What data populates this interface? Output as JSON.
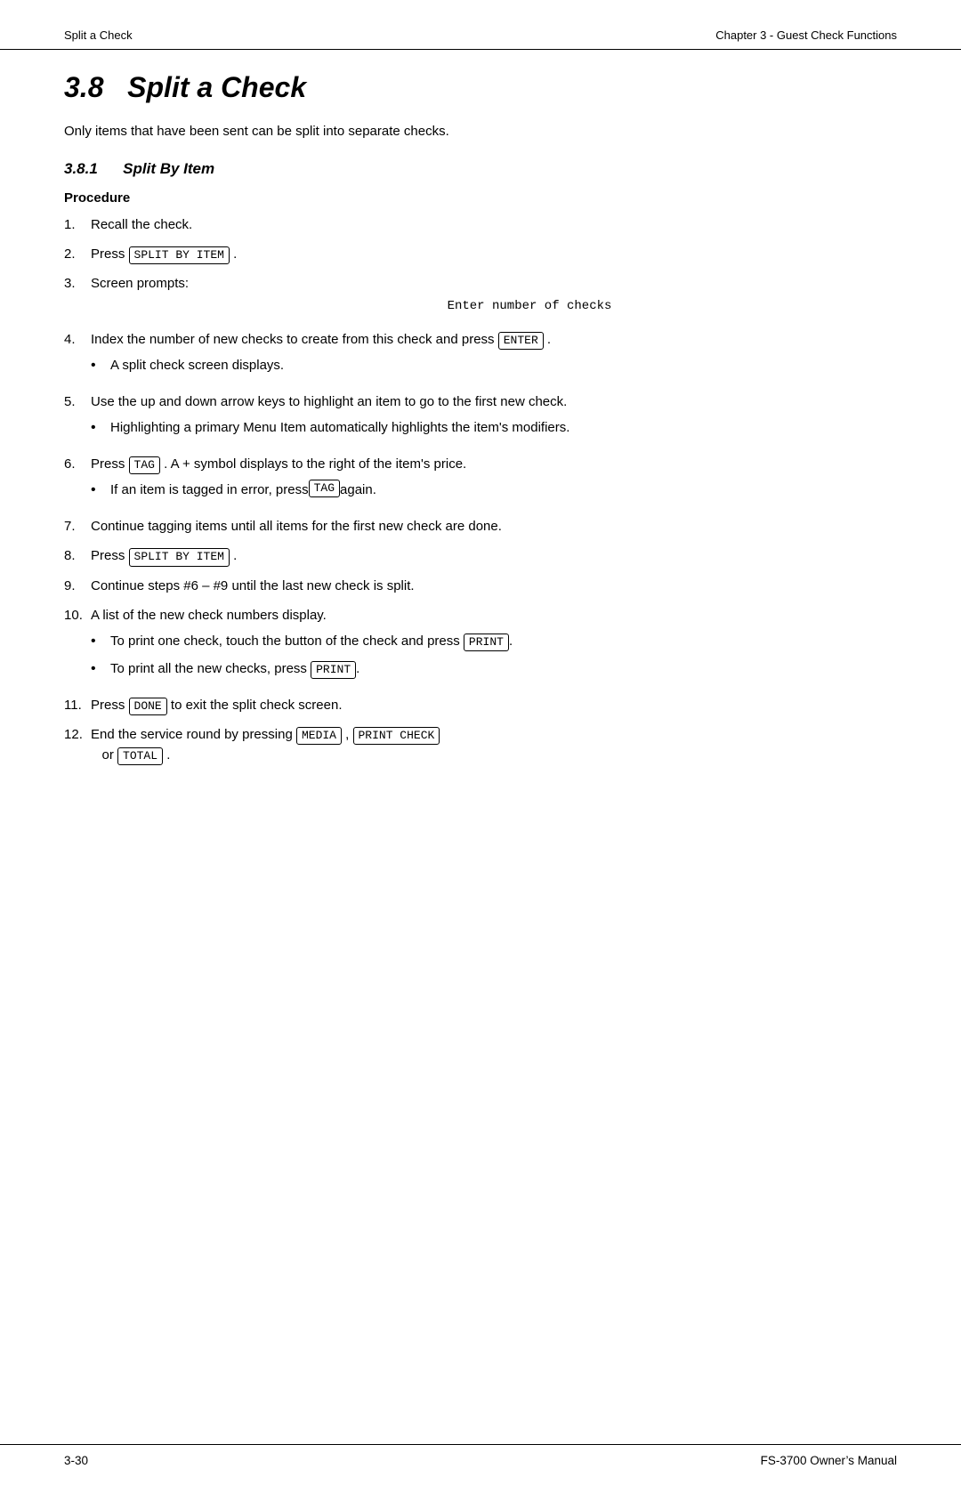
{
  "header": {
    "left": "Split a Check",
    "right": "Chapter 3 - Guest Check Functions"
  },
  "chapter": {
    "number": "3.8",
    "title": "Split a Check"
  },
  "intro": "Only items that have been sent can be split into separate checks.",
  "subsection": {
    "number": "3.8.1",
    "title": "Split By Item"
  },
  "procedure_heading": "Procedure",
  "steps": [
    {
      "text": "Recall the check.",
      "bullets": []
    },
    {
      "text_before": "Press ",
      "key": "SPLIT BY ITEM",
      "text_after": ".",
      "bullets": []
    },
    {
      "text": "Screen prompts:",
      "prompt": "Enter number of checks",
      "bullets": []
    },
    {
      "text_before": "Index the number of new checks to create from this check and press ",
      "key": "ENTER",
      "text_after": ".",
      "bullets": [
        "A split check screen displays."
      ]
    },
    {
      "text": "Use the up and down arrow keys to highlight an item to go to the first new check.",
      "bullets": [
        "Highlighting a primary Menu Item automatically highlights the item’s modifiers."
      ]
    },
    {
      "text_before": "Press ",
      "key": "TAG",
      "text_after": ". A + symbol displays to the right of the item’s price.",
      "bullets": [
        "If an item is tagged in error, press [TAG] again."
      ],
      "bullet_key_index": 0,
      "bullet_key": "TAG"
    },
    {
      "text": "Continue tagging items until all items for the first new check are done.",
      "bullets": []
    },
    {
      "text_before": "Press ",
      "key": "SPLIT BY ITEM",
      "text_after": ".",
      "bullets": []
    },
    {
      "text": "Continue steps #6 – #9 until the last new check is split.",
      "bullets": []
    },
    {
      "text": "A list of the new check numbers display.",
      "bullets": [
        "To print one check, touch the button of the check and press [PRINT].",
        "To print all the new checks, press [PRINT]."
      ],
      "bullet_keys": [
        "PRINT",
        "PRINT"
      ]
    },
    {
      "text_before": "Press ",
      "key": "DONE",
      "text_after": " to exit the split check screen.",
      "bullets": []
    },
    {
      "text_before": "End the service round by pressing ",
      "key1": "MEDIA",
      "text_mid": ", ",
      "key2": "PRINT CHECK",
      "text_after": " or ",
      "key3": "TOTAL",
      "text_end": ".",
      "bullets": []
    }
  ],
  "footer": {
    "left": "3-30",
    "right": "FS-3700 Owner’s Manual"
  }
}
